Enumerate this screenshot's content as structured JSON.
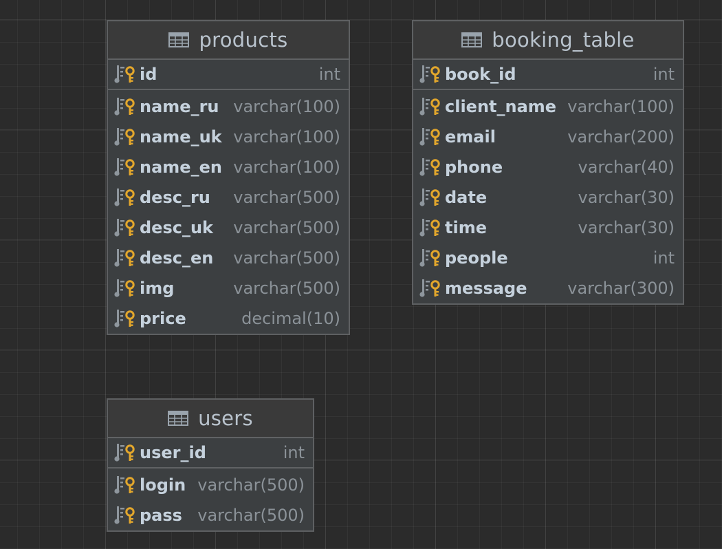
{
  "tables": [
    {
      "name": "products",
      "primary": {
        "name": "id",
        "type": "int"
      },
      "columns": [
        {
          "name": "name_ru",
          "type": "varchar(100)"
        },
        {
          "name": "name_uk",
          "type": "varchar(100)"
        },
        {
          "name": "name_en",
          "type": "varchar(100)"
        },
        {
          "name": "desc_ru",
          "type": "varchar(500)"
        },
        {
          "name": "desc_uk",
          "type": "varchar(500)"
        },
        {
          "name": "desc_en",
          "type": "varchar(500)"
        },
        {
          "name": "img",
          "type": "varchar(500)"
        },
        {
          "name": "price",
          "type": "decimal(10)"
        }
      ]
    },
    {
      "name": "booking_table",
      "primary": {
        "name": "book_id",
        "type": "int"
      },
      "columns": [
        {
          "name": "client_name",
          "type": "varchar(100)"
        },
        {
          "name": "email",
          "type": "varchar(200)"
        },
        {
          "name": "phone",
          "type": "varchar(40)"
        },
        {
          "name": "date",
          "type": "varchar(30)"
        },
        {
          "name": "time",
          "type": "varchar(30)"
        },
        {
          "name": "people",
          "type": "int"
        },
        {
          "name": "message",
          "type": "varchar(300)"
        }
      ]
    },
    {
      "name": "users",
      "primary": {
        "name": "user_id",
        "type": "int"
      },
      "columns": [
        {
          "name": "login",
          "type": "varchar(500)"
        },
        {
          "name": "pass",
          "type": "varchar(500)"
        }
      ]
    }
  ],
  "colors": {
    "canvas": "#2b2b2b",
    "table_bg": "#3c3f41",
    "border": "#5e6062",
    "key_icon": "#e3a72c",
    "column_name": "#c5d1dc",
    "column_type": "#8b9298",
    "table_title": "#b9c3cd"
  },
  "icons": {
    "table": "table-grid-icon",
    "primary_key": "primary-key-column-icon",
    "column": "column-key-icon"
  }
}
